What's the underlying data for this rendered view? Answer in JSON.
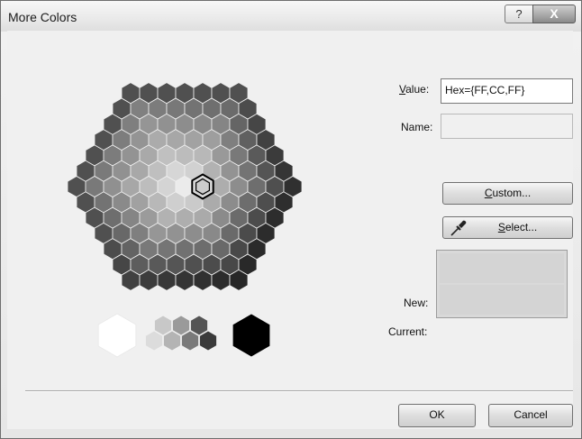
{
  "window": {
    "title": "More Colors",
    "help_glyph": "?",
    "close_glyph": "X"
  },
  "form": {
    "value_label": "Value:",
    "value_text": "Hex={FF,CC,FF}",
    "name_label": "Name:",
    "name_text": "",
    "custom_label": "Custom...",
    "select_label": "Select...",
    "new_label": "New:",
    "current_label": "Current:"
  },
  "buttons": {
    "ok": "OK",
    "cancel": "Cancel"
  },
  "icons": {
    "select_button_icon": "eyedropper-icon",
    "help_icon": "help-icon",
    "close_icon": "close-icon"
  },
  "palette": {
    "selected_color": "#FFCCFF",
    "preview_new": "#d4d4d4",
    "preview_current": "#d4d4d4"
  }
}
